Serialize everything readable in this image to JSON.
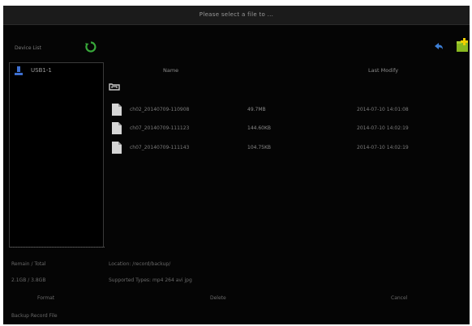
{
  "window": {
    "title": "Please select a file to ..."
  },
  "toolbar": {
    "device_label": "Device List",
    "refresh_icon": "refresh-icon",
    "back_icon": "back-arrow-icon",
    "new_folder_icon": "new-folder-icon"
  },
  "devices": [
    {
      "label": "USB1-1",
      "icon": "usb-drive-icon"
    }
  ],
  "file_list": {
    "headers": {
      "name": "Name",
      "size": "",
      "modified": "Last Modify"
    },
    "up_icon": "parent-folder-icon",
    "rows": [
      {
        "name": "ch02_20140709-110908",
        "size": "49.7MB",
        "modified": "2014-07-10 14:01:08"
      },
      {
        "name": "ch07_20140709-111123",
        "size": "144.60KB",
        "modified": "2014-07-10 14:02:19"
      },
      {
        "name": "ch07_20140709-111143",
        "size": "104.75KB",
        "modified": "2014-07-10 14:02:19"
      }
    ]
  },
  "info": {
    "capacity_label": "Remain / Total",
    "capacity_value": "2.1GB / 3.8GB",
    "location_line": "Location:    /record/backup/",
    "supported_line": "Supported Types: mp4   264   avi   jpg",
    "bottom_note": "Backup Record File"
  },
  "buttons": {
    "format": "Format",
    "delete": "Delete",
    "cancel": "Cancel"
  },
  "colors": {
    "background": "#050505",
    "titlebar": "#1b1b1b",
    "usb_icon": "#3d6fd0",
    "refresh_icon": "#38a83a",
    "back_icon": "#3d7fd6",
    "new_folder_icon": "#88b820"
  }
}
